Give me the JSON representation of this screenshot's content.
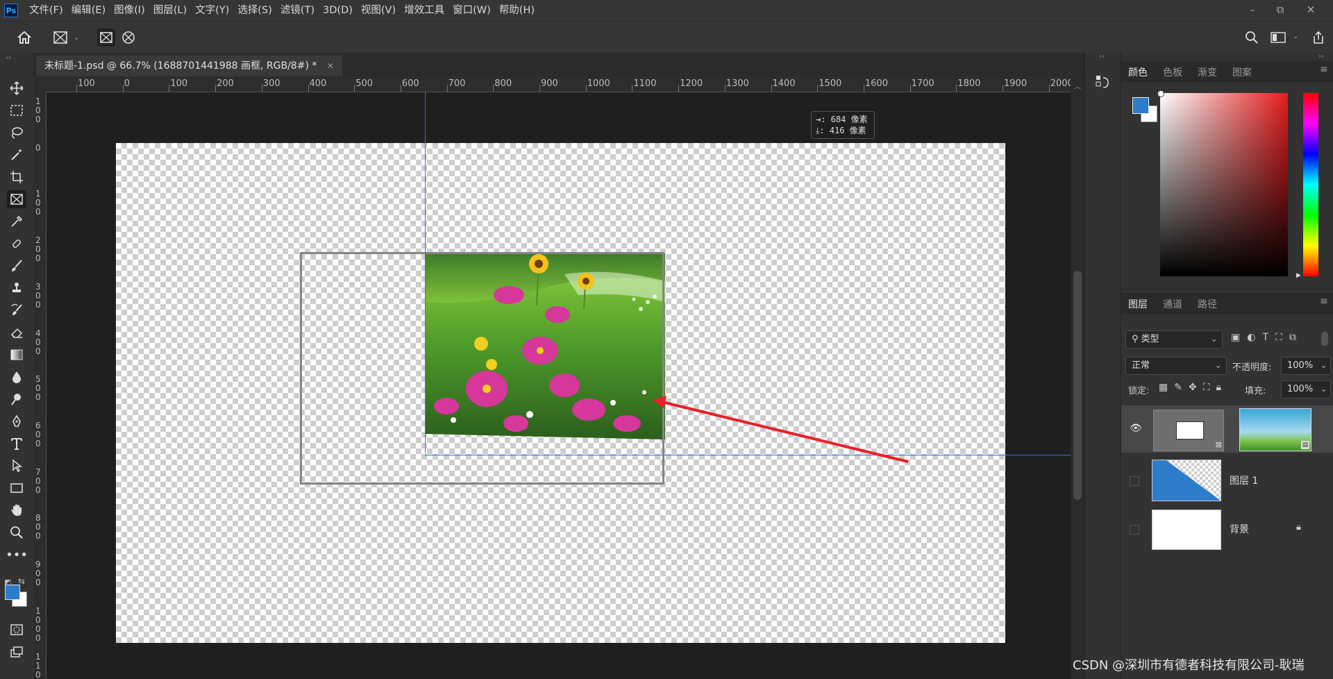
{
  "app": {
    "logo": "Ps",
    "menus": [
      "文件(F)",
      "编辑(E)",
      "图像(I)",
      "图层(L)",
      "文字(Y)",
      "选择(S)",
      "滤镜(T)",
      "3D(D)",
      "视图(V)",
      "增效工具",
      "窗口(W)",
      "帮助(H)"
    ]
  },
  "document": {
    "tab_title": "未标题-1.psd @ 66.7% (1688701441988 画框, RGB/8#) *"
  },
  "ruler": {
    "h_ticks": [
      "100",
      "0",
      "100",
      "200",
      "300",
      "400",
      "500",
      "600",
      "700",
      "800",
      "900",
      "1000",
      "1100",
      "1200",
      "1300",
      "1400",
      "1500",
      "1600",
      "1700",
      "1800",
      "1900",
      "2000"
    ],
    "v_ticks": [
      "100",
      "0",
      "100",
      "200",
      "300",
      "400",
      "500",
      "600",
      "700",
      "800",
      "900",
      "1000",
      "1100"
    ]
  },
  "tooltip": {
    "width_line": "⇥: 684 像素",
    "height_line": "⤓: 416 像素"
  },
  "color_panel": {
    "tabs": [
      "颜色",
      "色板",
      "渐变",
      "图案"
    ],
    "foreground": "#2d7cc9",
    "background": "#ffffff"
  },
  "layers_panel": {
    "tabs": [
      "图层",
      "通道",
      "路径"
    ],
    "filter_label": "类型",
    "blend_mode": "正常",
    "opacity_label": "不透明度:",
    "opacity_value": "100%",
    "lock_label": "锁定:",
    "fill_label": "填充:",
    "fill_value": "100%",
    "layers": [
      {
        "name": "",
        "visible": true,
        "kind": "frame"
      },
      {
        "name": "图层 1",
        "visible": false,
        "kind": "shape"
      },
      {
        "name": "背景",
        "visible": false,
        "kind": "background",
        "locked": true
      }
    ]
  },
  "watermark": "CSDN @深圳市有德者科技有限公司-耿瑞"
}
